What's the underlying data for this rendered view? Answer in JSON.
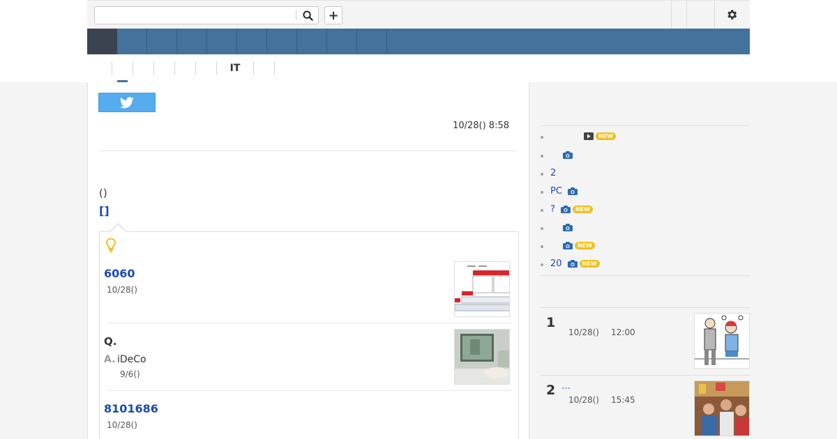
{
  "header": {
    "search": {
      "value": "",
      "placeholder": ""
    }
  },
  "nav": {
    "items": [
      "",
      "",
      "",
      "",
      "",
      "",
      "",
      "",
      "",
      ""
    ]
  },
  "category_tabs": [
    "",
    "",
    "",
    "",
    "",
    "IT",
    "",
    ""
  ],
  "article": {
    "date": "10/28() 8:58",
    "paren_text": "()",
    "bracket_link": "[]"
  },
  "related": {
    "items": [
      {
        "type": "article",
        "title": "6060",
        "date": "10/28()"
      },
      {
        "type": "qa",
        "question": "Q.",
        "answer_label": "A.",
        "answer": "iDeCo",
        "date": "9/6()"
      },
      {
        "type": "article",
        "title": "8101686",
        "date": "10/28()"
      }
    ]
  },
  "sidebar": {
    "topics": [
      {
        "text": "",
        "icon": "play-icon",
        "new": "NEW"
      },
      {
        "text": "",
        "icon": "camera-icon",
        "new": ""
      },
      {
        "text": "2",
        "icon": "",
        "new": ""
      },
      {
        "text": "PC",
        "icon": "camera-icon",
        "new": ""
      },
      {
        "text": "?",
        "icon": "camera-icon",
        "new": "NEW"
      },
      {
        "text": "",
        "icon": "camera-icon",
        "new": ""
      },
      {
        "text": "",
        "icon": "camera-icon",
        "new": "NEW"
      },
      {
        "text": "20",
        "icon": "camera-icon",
        "new": "NEW"
      }
    ],
    "ranking": [
      {
        "rank": "1",
        "text": "",
        "date": "10/28()",
        "time": "12:00"
      },
      {
        "rank": "2",
        "text": "…",
        "date": "10/28()",
        "time": "15:45"
      }
    ]
  },
  "colors": {
    "nav_bg": "#44729c",
    "nav_home_bg": "#3b4351",
    "link": "#1a4ab5",
    "twitter": "#55acee",
    "new_badge": "#f0c020"
  }
}
